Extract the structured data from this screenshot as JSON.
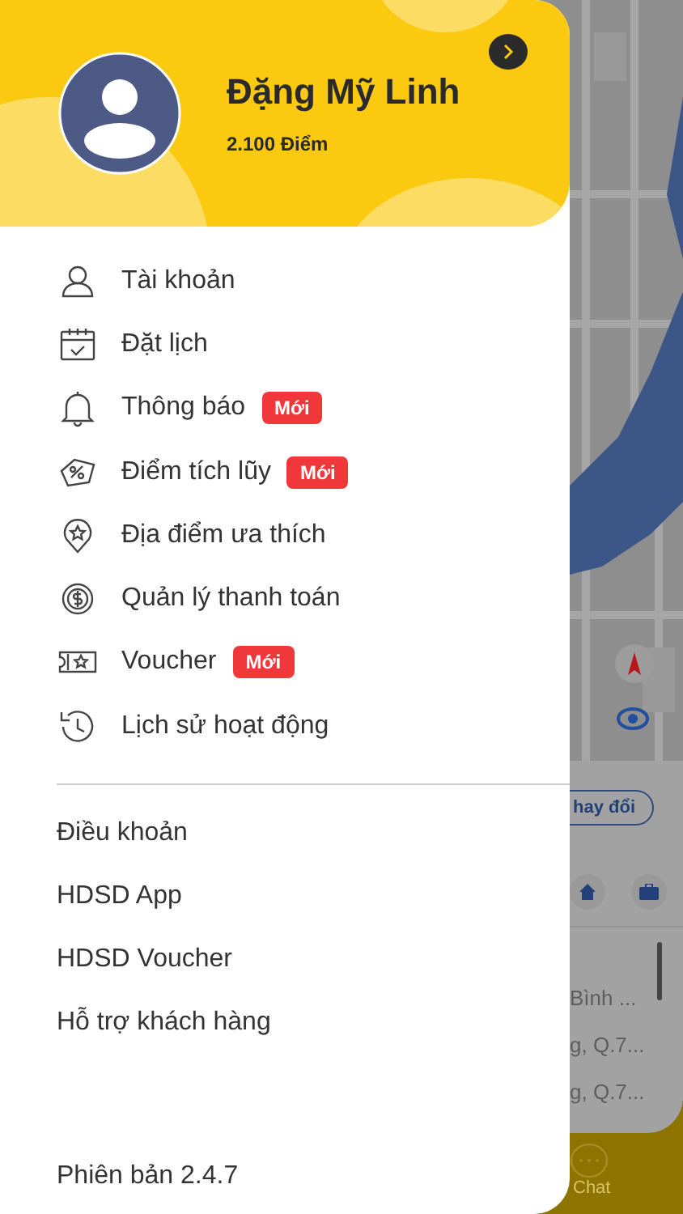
{
  "profile": {
    "name": "Đặng Mỹ Linh",
    "points": "2.100 Điểm"
  },
  "menu": [
    {
      "label": "Tài khoản"
    },
    {
      "label": "Đặt lịch"
    },
    {
      "label": "Thông báo",
      "badge": "Mới"
    },
    {
      "label": "Điểm tích lũy",
      "badge": "Mới"
    },
    {
      "label": "Địa điểm ưa thích"
    },
    {
      "label": "Quản lý thanh toán"
    },
    {
      "label": "Voucher",
      "badge": "Mới"
    },
    {
      "label": "Lịch sử hoạt động"
    }
  ],
  "links": [
    "Điều khoản",
    "HDSD App",
    "HDSD Voucher",
    "Hỗ trợ khách hàng"
  ],
  "version": "Phiên bản 2.4.7",
  "background": {
    "change_button": "hay đổi",
    "places": [
      "Bình ...",
      "g, Q.7...",
      "g, Q.7..."
    ],
    "chat_label": "Chat"
  }
}
